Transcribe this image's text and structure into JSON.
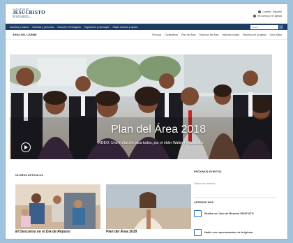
{
  "header": {
    "logo": {
      "line1": "LA IGLESIA DE",
      "line2": "JESUCRISTO",
      "line3": "DE LOS SANTOS",
      "line4": "DE LOS ÚLTIMOS DÍAS"
    },
    "links": [
      {
        "label": "Cuenta · Español",
        "icon": "globe-icon"
      },
      {
        "label": "Mi cuenta y mi Iglesia",
        "icon": "user-icon"
      }
    ]
  },
  "nav": {
    "items": [
      "Doctrina y cultura",
      "Familias y personas",
      "Escuche el Evangelio",
      "Inspiración y mensajes",
      "Pistas servicio y ayuda"
    ],
    "search_placeholder": "Buscar"
  },
  "subnav": {
    "title": "ÁREA DEL CARIBE",
    "items": [
      "Principal",
      "Contáctenos",
      "Plan del Área",
      "Recursos del Área",
      "Historias locales",
      "Recursos de la Iglesia",
      "Otros Sitios"
    ]
  },
  "hero": {
    "title": "Plan del Área 2018",
    "subtitle": "VIDEO: Una invitación para todos, por el élder Walter F. González"
  },
  "articles": {
    "label": "ÚLTIMOS ARTÍCULOS",
    "items": [
      {
        "caption": "El Descanso en el Día de Reposo"
      },
      {
        "caption": "Plan del Área 2018"
      }
    ]
  },
  "events": {
    "label": "PRÓXIMOS EVENTOS",
    "link": "Todos los eventos"
  },
  "learn": {
    "label": "APRENDE MÁS",
    "items": [
      {
        "label": "Reciba un Libro de Mormón GRATUITO",
        "icon": "book-icon"
      },
      {
        "label": "Hable con representantes de la Iglesia",
        "icon": "chat-icon"
      }
    ]
  },
  "colors": {
    "nav_bg": "#1e3c66",
    "link": "#4a8bc2",
    "accent": "#2c73b8",
    "outer_bg": "#9fc3dc"
  }
}
